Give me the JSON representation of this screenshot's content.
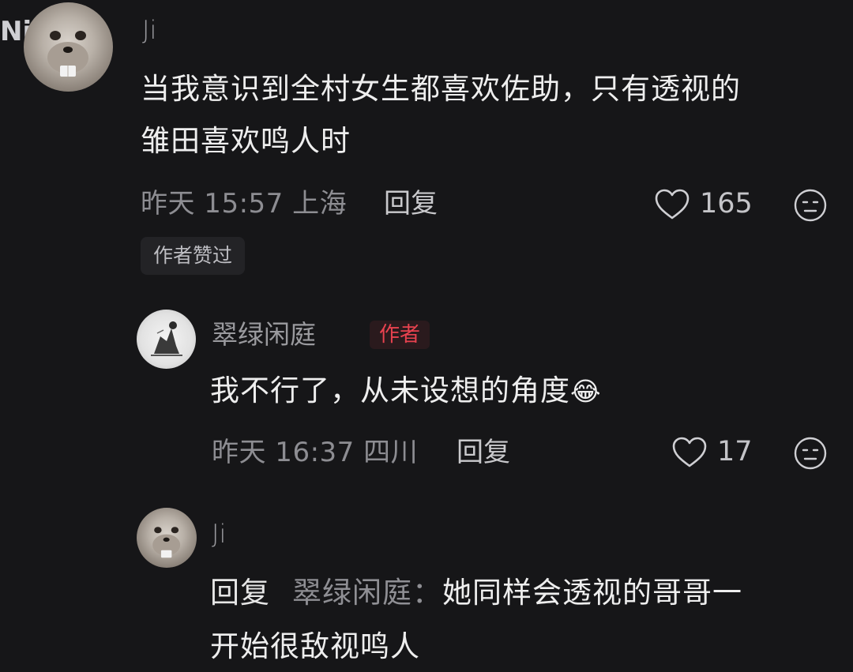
{
  "edge_text": "Ni",
  "comments": [
    {
      "user": "Ji",
      "text_line1": "当我意识到全村女生都喜欢佐助，只有透视的",
      "text_line2": "雏田喜欢鸣人时",
      "time": "昨天 15:57 上海",
      "reply_label": "回复",
      "likes": "165",
      "author_liked_label": "作者赞过"
    },
    {
      "user": "翠绿闲庭",
      "badge": "作者",
      "text": "我不行了，从未设想的角度",
      "emoji": "😂",
      "time": "昨天 16:37 四川",
      "reply_label": "回复",
      "likes": "17"
    },
    {
      "user": "Ji",
      "reply_prefix": "回复",
      "reply_target": "翠绿闲庭：",
      "text_line1": "她同样会透视的哥哥一",
      "text_line2": "开始很敌视鸣人"
    }
  ],
  "icons": {
    "like": "heart-outline-icon",
    "dislike": "sad-face-icon"
  },
  "colors": {
    "background": "#161618",
    "author_badge": "#e8424f"
  }
}
